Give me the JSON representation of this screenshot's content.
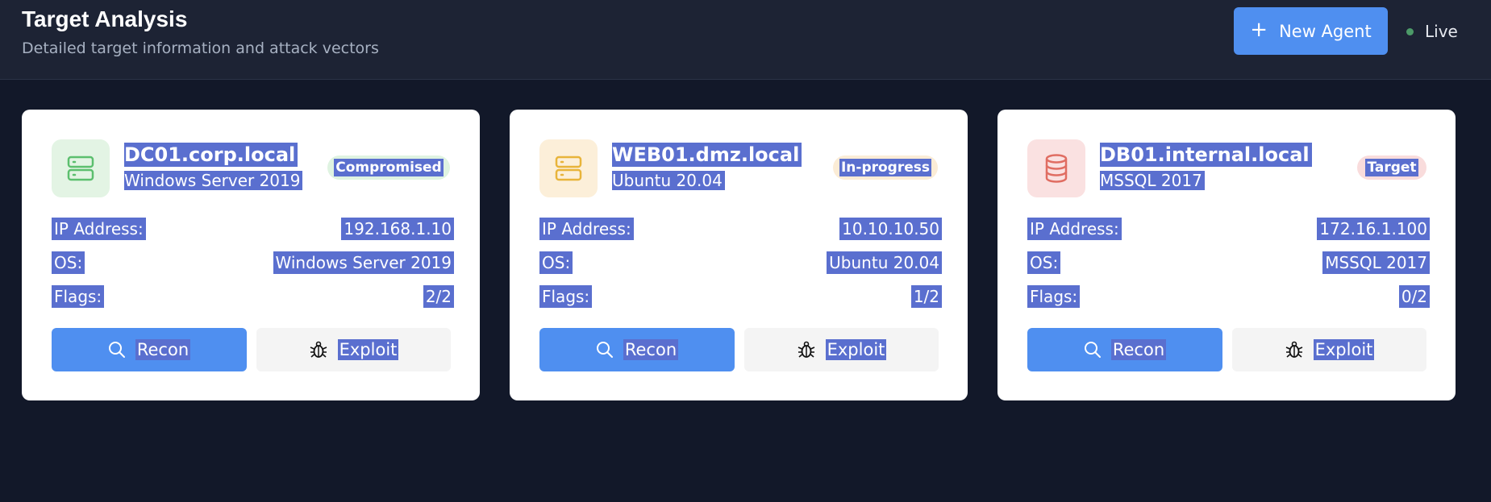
{
  "header": {
    "title": "Target Analysis",
    "subtitle": "Detailed target information and attack vectors",
    "new_agent_label": "New Agent",
    "live_label": "Live"
  },
  "labels": {
    "ip": "IP Address:",
    "os": "OS:",
    "flags": "Flags:",
    "recon": "Recon",
    "exploit": "Exploit"
  },
  "targets": [
    {
      "name": "DC01.corp.local",
      "subtitle": "Windows Server 2019",
      "status": "Compromised",
      "status_color": "#dff3e1",
      "icon": "server-icon",
      "icon_bg": "#e3f4e4",
      "icon_color": "#5cbf6e",
      "ip": "192.168.1.10",
      "os": "Windows Server 2019",
      "flags": "2/2"
    },
    {
      "name": "WEB01.dmz.local",
      "subtitle": "Ubuntu 20.04",
      "status": "In-progress",
      "status_color": "#fbecd6",
      "icon": "server-icon",
      "icon_bg": "#fcefd9",
      "icon_color": "#e8b43a",
      "ip": "10.10.10.50",
      "os": "Ubuntu 20.04",
      "flags": "1/2"
    },
    {
      "name": "DB01.internal.local",
      "subtitle": "MSSQL 2017",
      "status": "Target",
      "status_color": "#f9dcdc",
      "icon": "database-icon",
      "icon_bg": "#fae1e1",
      "icon_color": "#e06d62",
      "ip": "172.16.1.100",
      "os": "MSSQL 2017",
      "flags": "0/2"
    }
  ]
}
